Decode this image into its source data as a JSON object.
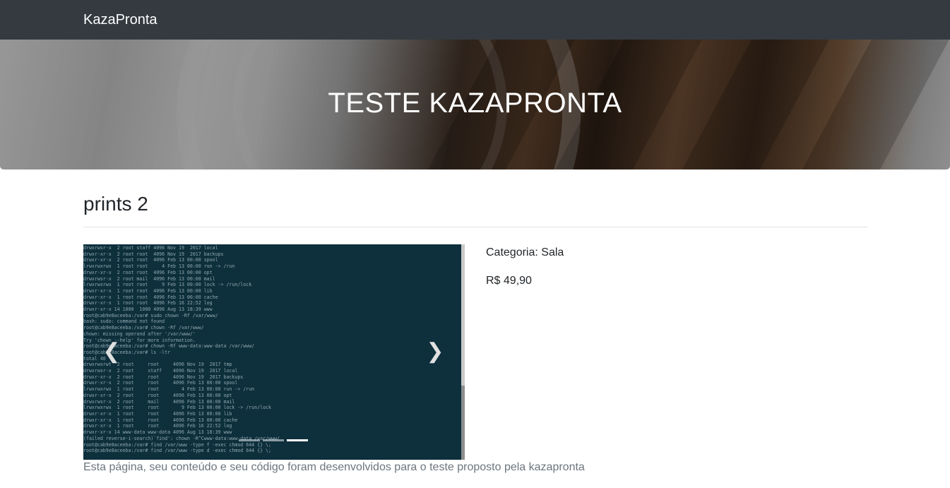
{
  "navbar": {
    "brand": "KazaPronta"
  },
  "hero": {
    "title": "TESTE KAZAPRONTA"
  },
  "product": {
    "title": "prints 2",
    "category_label": "Categoria: Sala",
    "price": "R$ 49,90"
  },
  "carousel": {
    "terminal_text": "drwxrwsr-x  2 root staff 4096 Nov 19  2017 local\ndrwxr-xr-x  2 root root  4096 Nov 19  2017 backups\ndrwxr-xr-x  2 root root  4096 Feb 13 00:00 spool\nlrwxrwxrwx  1 root root     4 Feb 13 00:00 run -> /run\ndrwxr-xr-x  2 root root  4096 Feb 13 00:00 opt\ndrwxrwsr-x  2 root mail  4096 Feb 13 00:00 mail\nlrwxrwxrwx  1 root root     9 Feb 13 00:00 lock -> /run/lock\ndrwxr-xr-x  1 root root  4096 Feb 13 00:00 lib\ndrwxr-xr-x  1 root root  4096 Feb 13 00:00 cache\ndrwxr-xr-x  1 root root  4096 Feb 16 22:52 log\ndrwxr-xr-x 14 1000  1000 4096 Aug 13 18:39 www\nroot@cab9e8aceeba:/var# sudo chown -Rf /var/www/\nbash: sudo: command not found\nroot@cab9e8aceeba:/var# chown -Rf /var/www/\nchown: missing operand after '/var/www/'\nTry 'chown --help' for more information.\nroot@cab9e8aceeba:/var# chown -Rf www-data:www-data /var/www/\nroot@cab9e8aceeba:/var# ls -ltr\ntotal 40\ndrwxrwxrwt  2 root     root     4096 Nov 19  2017 tmp\ndrwxrwsr-x  2 root     staff    4096 Nov 19  2017 local\ndrwxr-xr-x  2 root     root     4096 Nov 19  2017 backups\ndrwxr-xr-x  2 root     root     4096 Feb 13 00:00 spool\nlrwxrwxrwx  1 root     root        4 Feb 13 00:00 run -> /run\ndrwxr-xr-x  2 root     root     4096 Feb 13 00:00 opt\ndrwxrwsr-x  2 root     mail     4096 Feb 13 00:00 mail\nlrwxrwxrwx  1 root     root        9 Feb 13 00:00 lock -> /run/lock\ndrwxr-xr-x  1 root     root     4096 Feb 13 00:00 lib\ndrwxr-xr-x  1 root     root     4096 Feb 13 00:00 cache\ndrwxr-xr-x  1 root     root     4096 Feb 16 22:52 log\ndrwxr-xr-x 14 www-data www-data 4096 Aug 13 18:39 www\n(failed reverse-i-search)`find': chown -R^Cwww-data:www-data /var/www/\nroot@cab9e8aceeba:/var# find /var/www -type f -exec chmod 644 {} \\;\nroot@cab9e8aceeba:/var# find /var/www -type d -exec chmod 644 {} \\;",
    "prev_icon": "chevron-left-icon",
    "next_icon": "chevron-right-icon",
    "active_slide": 3,
    "slide_count": 3
  },
  "footer": {
    "text": "Esta página, seu conteúdo e seu código foram desenvolvidos para o teste proposto pela kazapronta"
  },
  "colors": {
    "navbar_bg": "#343a40",
    "terminal_bg": "#0e2f3c",
    "footer_text": "#6c757d"
  }
}
